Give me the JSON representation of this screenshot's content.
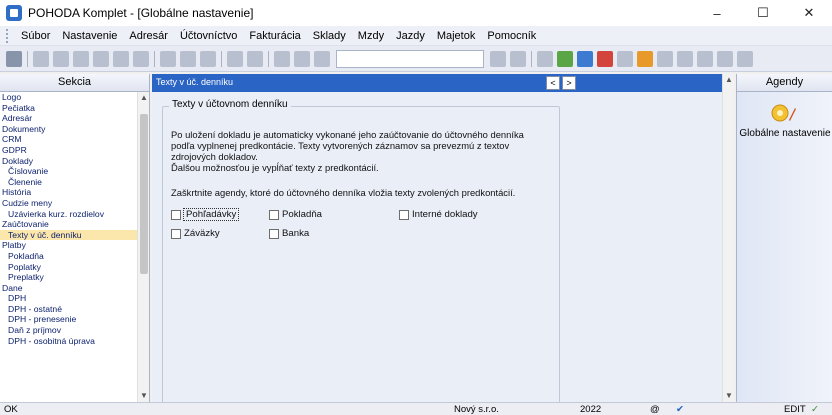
{
  "window": {
    "title": "POHODA Komplet - [Globálne nastavenie]",
    "controls": {
      "minimize": "–",
      "maximize": "☐",
      "close": "✕"
    }
  },
  "menu": [
    "Súbor",
    "Nastavenie",
    "Adresár",
    "Účtovníctvo",
    "Fakturácia",
    "Sklady",
    "Mzdy",
    "Jazdy",
    "Majetok",
    "Pomocník"
  ],
  "sekcia": {
    "header": "Sekcia",
    "items": [
      {
        "label": "Logo",
        "sub": false
      },
      {
        "label": "Pečiatka",
        "sub": false
      },
      {
        "label": "Adresár",
        "sub": false
      },
      {
        "label": "Dokumenty",
        "sub": false
      },
      {
        "label": "CRM",
        "sub": false
      },
      {
        "label": "GDPR",
        "sub": false
      },
      {
        "label": "Doklady",
        "sub": false
      },
      {
        "label": "Číslovanie",
        "sub": true
      },
      {
        "label": "Členenie",
        "sub": true
      },
      {
        "label": "História",
        "sub": false
      },
      {
        "label": "Cudzie meny",
        "sub": false
      },
      {
        "label": "Uzávierka kurz. rozdielov",
        "sub": true
      },
      {
        "label": "Zaúčtovanie",
        "sub": false
      },
      {
        "label": "Texty v úč. denníku",
        "sub": true,
        "selected": true
      },
      {
        "label": "Platby",
        "sub": false
      },
      {
        "label": "Pokladňa",
        "sub": true
      },
      {
        "label": "Poplatky",
        "sub": true
      },
      {
        "label": "Preplatky",
        "sub": true
      },
      {
        "label": "Dane",
        "sub": false
      },
      {
        "label": "DPH",
        "sub": true
      },
      {
        "label": "DPH - ostatné",
        "sub": true
      },
      {
        "label": "DPH - prenesenie",
        "sub": true
      },
      {
        "label": "Daň z príjmov",
        "sub": true
      },
      {
        "label": "DPH - osobitná úprava",
        "sub": true
      }
    ]
  },
  "content": {
    "header": "Texty v úč. denníku",
    "nav_prev": "<",
    "nav_next": ">",
    "group_title": "Texty v účtovnom denníku",
    "paragraph1_lines": [
      "Po uložení dokladu je automaticky vykonané jeho zaúčtovanie do účtovného denníka",
      "podľa vyplnenej predkontácie. Texty vytvorených záznamov sa prevezmú z textov",
      "zdrojových dokladov.",
      "Ďalšou možnosťou je vypĺňať texty z predkontácií."
    ],
    "paragraph2": "Zaškrtnite agendy, ktoré do účtovného denníka vložia texty zvolených predkontácií.",
    "checkboxes": [
      {
        "label": "Pohľadávky",
        "checked": false,
        "focused": true
      },
      {
        "label": "Pokladňa",
        "checked": false
      },
      {
        "label": "Interné doklady",
        "checked": false
      },
      {
        "label": "Záväzky",
        "checked": false
      },
      {
        "label": "Banka",
        "checked": false
      }
    ]
  },
  "agendy": {
    "header": "Agendy",
    "item_label": "Globálne nastavenie",
    "item_icon": "settings-agenda-icon"
  },
  "status": {
    "left": "OK",
    "company": "Nový s.r.o.",
    "year": "2022",
    "at": "@",
    "mode": "EDIT"
  }
}
